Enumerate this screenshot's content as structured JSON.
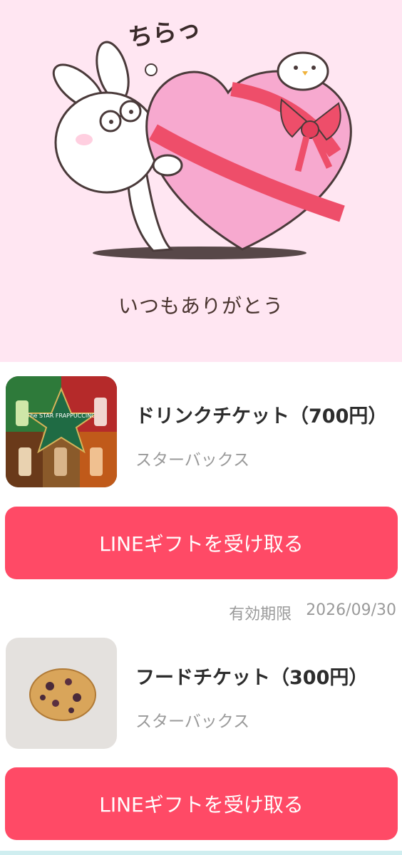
{
  "card": {
    "sound_text": "ちらっ",
    "message": "いつもありがとう"
  },
  "gifts": [
    {
      "name": "ドリンクチケット（700円）",
      "brand": "スターバックス",
      "thumb_label": "The STAR FRAPPUCCINO",
      "cta": "LINEギフトを受け取る"
    },
    {
      "name": "フードチケット（300円）",
      "brand": "スターバックス",
      "cta": "LINEギフトを受け取る"
    }
  ],
  "expiry": {
    "label": "有効期限",
    "date": "2026/09/30"
  },
  "colors": {
    "hero_bg": "#ffe6f2",
    "cta": "#ff4a66",
    "heart": "#f7a9cf",
    "ribbon": "#ee4e6a"
  }
}
